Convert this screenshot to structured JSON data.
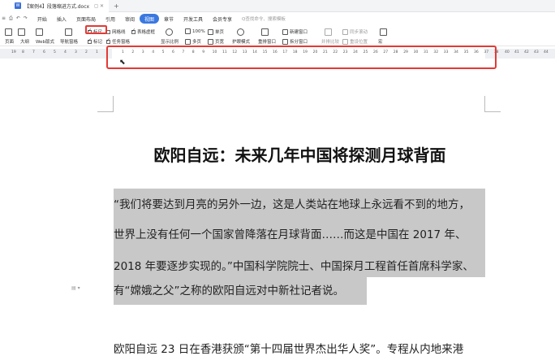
{
  "titlebar": {
    "app_icon": "W",
    "doc_name": "【案例4】段落缩进方式.docx",
    "tab_icons": "◻ ✕",
    "new_tab": "+"
  },
  "menubar": {
    "quick_access": [
      "≡",
      "⎙",
      "↶",
      "↷"
    ],
    "items": [
      "开始",
      "插入",
      "页面布局",
      "引用",
      "审阅",
      "视图",
      "章节",
      "开发工具",
      "会员专享"
    ],
    "active": "视图",
    "search_placeholder": "Q查找命令、搜索模板"
  },
  "toolbar": {
    "view_buttons": [
      "页面",
      "大纲",
      "Web版式"
    ],
    "nav_pane": "导航窗格",
    "ruler_check": "标尺",
    "gridlines_check": "网格线",
    "table_gridlines_check": "表格虚框",
    "markup_check": "标记",
    "task_pane_check": "任务窗格",
    "display_ratio": "显示比例",
    "zoom_label": "100%",
    "single_page": "单页",
    "multi_page": "多页",
    "page_width": "页宽",
    "eye_mode": "护眼模式",
    "new_window": "新建窗口",
    "rearrange": "重排窗口",
    "split_window": "拆分窗口",
    "parallel": "并排比较",
    "sync_scroll": "同步滚动",
    "reset_pos": "重设位置",
    "macro": "宏"
  },
  "ruler": {
    "left_marks": [
      "19",
      "8",
      "7",
      "6",
      "5",
      "4",
      "3",
      "2",
      "1"
    ],
    "marks": [
      "1",
      "2",
      "3",
      "4",
      "5",
      "6",
      "7",
      "8",
      "9",
      "10",
      "11",
      "12",
      "13",
      "14",
      "15",
      "16",
      "17",
      "18",
      "19",
      "20",
      "21",
      "22",
      "23",
      "24",
      "25",
      "26",
      "27",
      "28",
      "29",
      "30",
      "31",
      "32",
      "33",
      "34",
      "35",
      "36",
      "37",
      "38"
    ],
    "right_marks": [
      "40",
      "41",
      "42",
      "43",
      "44"
    ]
  },
  "document": {
    "title": "欧阳自远：未来几年中国将探测月球背面",
    "lines": [
      "“我们将要达到月亮的另外一边，这是人类站在地球上永远看不到的地方，",
      "世界上没有任何一个国家曾降落在月球背面……而这是中国在 2017 年、",
      "2018 年要逐步实现的。”中国科学院院士、中国探月工程首任首席科学家、",
      "有“嫦娥之父”之称的欧阳自远对中新社记者说。"
    ],
    "next_line": "欧阳自远 23 日在香港获颁“第十四届世界杰出华人奖”。专程从内地来港",
    "margin_mark": "▤ ▾"
  }
}
